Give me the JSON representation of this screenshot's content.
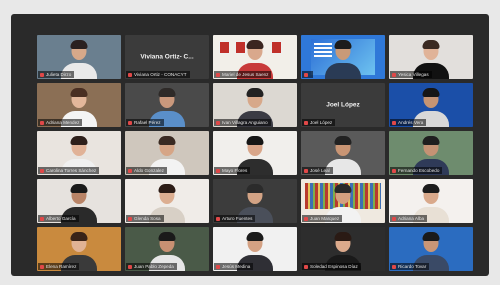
{
  "window": {
    "title": ""
  },
  "participants": [
    {
      "name": "Julieta Dirzo",
      "kind": "video",
      "bg": "#6a7f8f",
      "skin": "#d7a98a",
      "hair": "#2a2120",
      "shirt": "#e9e9e9"
    },
    {
      "name": "Viviana Ortiz - CONACYT",
      "display": "Viviana Ortiz- C...",
      "kind": "blank"
    },
    {
      "name": "Mariel de Jesus Saenz",
      "kind": "video",
      "bg": "#f2efe9",
      "skin": "#d9a88c",
      "hair": "#3a2520",
      "shirt": "#c83a3a",
      "decor": "frames"
    },
    {
      "name": "",
      "kind": "video",
      "bg": "#2f78d8",
      "skin": "#c99a78",
      "hair": "#1c1c1c",
      "shirt": "#2a3b55",
      "decor": "poster"
    },
    {
      "name": "Yesica Villegas",
      "kind": "video",
      "bg": "#e2dfdc",
      "skin": "#e0b398",
      "hair": "#3a2a22",
      "shirt": "#111111"
    },
    {
      "name": "Adriana Mendez",
      "kind": "video",
      "bg": "#8b6f55",
      "skin": "#e3b79b",
      "hair": "#4a2f22",
      "shirt": "#f4f4f4"
    },
    {
      "name": "Rafael Pérez",
      "kind": "video",
      "bg": "#4a4a4a",
      "skin": "#c9987c",
      "hair": "#2e2a28",
      "shirt": "#5a8fc9"
    },
    {
      "name": "Ivan Villagra Anguiano",
      "kind": "video",
      "bg": "#dcd8d2",
      "skin": "#d7a88a",
      "hair": "#222222",
      "shirt": "#3b3b44"
    },
    {
      "name": "Joel López",
      "display": "Joel López",
      "kind": "blank"
    },
    {
      "name": "Andrés Vera",
      "kind": "video",
      "bg": "#1b4fa8",
      "skin": "#c59473",
      "hair": "#161616",
      "shirt": "#d8d8d8"
    },
    {
      "name": "Carolina Torres Sánchez",
      "kind": "video",
      "bg": "#e9e4df",
      "skin": "#e1b297",
      "hair": "#2e1f1a",
      "shirt": "#f0f0f0"
    },
    {
      "name": "Aldo Gonzalez",
      "kind": "video",
      "bg": "#cfc7bd",
      "skin": "#d6a586",
      "hair": "#3a2a22",
      "shirt": "#f3f3f3"
    },
    {
      "name": "Mayo Flores",
      "kind": "video",
      "bg": "#f1efec",
      "skin": "#d9a68a",
      "hair": "#161616",
      "shirt": "#2d2d2d"
    },
    {
      "name": "José Leal",
      "kind": "video",
      "bg": "#5a5a5a",
      "skin": "#c99574",
      "hair": "#222222",
      "shirt": "#e7e7e7"
    },
    {
      "name": "Fernando Escobedo",
      "kind": "video",
      "bg": "#6e8c6e",
      "skin": "#c49274",
      "hair": "#1f1f1f",
      "shirt": "#2f3a58"
    },
    {
      "name": "Alberto García",
      "kind": "video",
      "bg": "#e6e2de",
      "skin": "#b98467",
      "hair": "#1a1a1a",
      "shirt": "#2a2a2a"
    },
    {
      "name": "Glenda Sosa",
      "kind": "video",
      "bg": "#f0ece8",
      "skin": "#dcae91",
      "hair": "#2c1c16",
      "shirt": "#d8d0c6"
    },
    {
      "name": "Arturo Fuentes",
      "kind": "video",
      "bg": "#3c3c3c",
      "skin": "#d3a385",
      "hair": "#2b2b2b",
      "shirt": "#4a4f5a"
    },
    {
      "name": "Juan Marquez",
      "kind": "video",
      "bg": "#efe9e0",
      "skin": "#d4a080",
      "hair": "#2a2a2a",
      "shirt": "#f2f2f2",
      "decor": "books"
    },
    {
      "name": "Adriana Alba",
      "kind": "video",
      "bg": "#f4f1ee",
      "skin": "#d9a98b",
      "hair": "#1c1c1c",
      "shirt": "#e8e0d5"
    },
    {
      "name": "Elena Ramírez",
      "kind": "video",
      "bg": "#c98a3e",
      "skin": "#e1b394",
      "hair": "#3a2418",
      "shirt": "#3a3a3a"
    },
    {
      "name": "Juan Pablo Zepeda",
      "kind": "video",
      "bg": "#4a5a48",
      "skin": "#c89072",
      "hair": "#1a1a1a",
      "shirt": "#e6e6e6"
    },
    {
      "name": "Jesús Medina",
      "kind": "video",
      "bg": "#f1f1f1",
      "skin": "#d4a183",
      "hair": "#1b1b1b",
      "shirt": "#2f2f35"
    },
    {
      "name": "Soledad Espinosa Díaz",
      "kind": "video",
      "bg": "#2d2d2d",
      "skin": "#dcaa8c",
      "hair": "#2a1a14",
      "shirt": "#1a1a1a"
    },
    {
      "name": "Ricardo Tovar",
      "kind": "video",
      "bg": "#2b6cc0",
      "skin": "#c99676",
      "hair": "#1a1a1a",
      "shirt": "#3a4a66"
    }
  ]
}
